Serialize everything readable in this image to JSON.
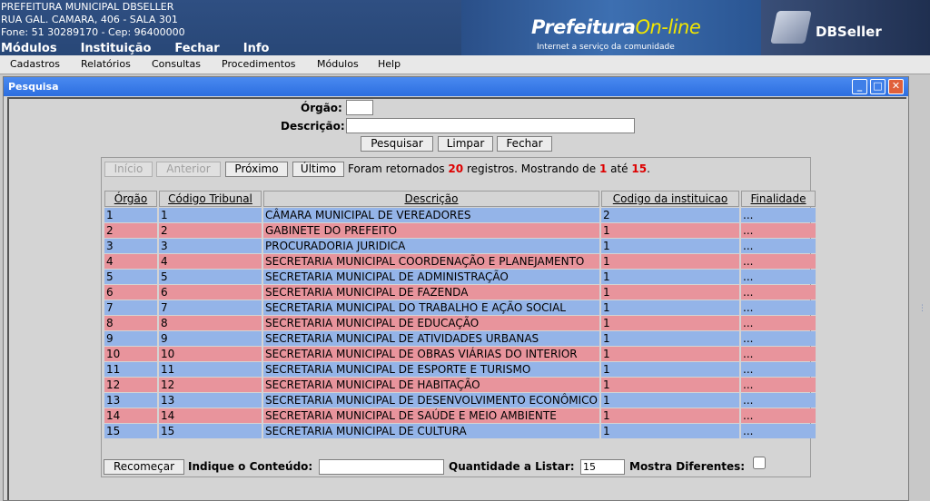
{
  "header": {
    "org_lines": [
      "PREFEITURA MUNICIPAL DBSELLER",
      "RUA GAL. CAMARA, 406 - SALA 301",
      "Fone: 51 30289170  -  Cep: 96400000"
    ],
    "top_menu": [
      "Módulos",
      "Instituição",
      "Fechar",
      "Info"
    ],
    "logo_main": "Prefeitura",
    "logo_online": "On-line",
    "logo_sub": "Internet a serviço da comunidade",
    "brand": "DBSeller"
  },
  "menubar": [
    "Cadastros",
    "Relatórios",
    "Consultas",
    "Procedimentos",
    "Módulos",
    "Help"
  ],
  "window": {
    "title": "Pesquisa",
    "min": "_",
    "max": "□",
    "close": "✕"
  },
  "form": {
    "orgao_label": "Órgão:",
    "orgao_value": "",
    "descricao_label": "Descrição:",
    "descricao_value": "",
    "pesquisar": "Pesquisar",
    "limpar": "Limpar",
    "fechar": "Fechar"
  },
  "pager": {
    "inicio": "Início",
    "anterior": "Anterior",
    "proximo": "Próximo",
    "ultimo": "Último",
    "text1": "Foram retornados ",
    "total": "20",
    "text2": " registros. Mostrando de ",
    "from": "1",
    "text3": " até ",
    "to": "15",
    "text4": "."
  },
  "table": {
    "headers": [
      "Órgão",
      "Código Tribunal",
      "Descrição",
      "Codigo da instituicao",
      "Finalidade"
    ],
    "rows": [
      [
        "1",
        "1",
        "CÂMARA MUNICIPAL DE VEREADORES",
        "2",
        "..."
      ],
      [
        "2",
        "2",
        "GABINETE DO PREFEITO",
        "1",
        "..."
      ],
      [
        "3",
        "3",
        "PROCURADORIA JURIDICA",
        "1",
        "..."
      ],
      [
        "4",
        "4",
        "SECRETARIA MUNICIPAL COORDENAÇÃO E PLANEJAMENTO",
        "1",
        "..."
      ],
      [
        "5",
        "5",
        "SECRETARIA MUNICIPAL DE ADMINISTRAÇÃO",
        "1",
        "..."
      ],
      [
        "6",
        "6",
        "SECRETARIA MUNICIPAL DE FAZENDA",
        "1",
        "..."
      ],
      [
        "7",
        "7",
        "SECRETARIA MUNICIPAL DO TRABALHO E AÇÃO SOCIAL",
        "1",
        "..."
      ],
      [
        "8",
        "8",
        "SECRETARIA MUNICIPAL DE EDUCAÇÃO",
        "1",
        "..."
      ],
      [
        "9",
        "9",
        "SECRETARIA MUNICIPAL DE ATIVIDADES URBANAS",
        "1",
        "..."
      ],
      [
        "10",
        "10",
        "SECRETARIA MUNICIPAL DE OBRAS VIÁRIAS DO INTERIOR",
        "1",
        "..."
      ],
      [
        "11",
        "11",
        "SECRETARIA MUNICIPAL DE ESPORTE E TURISMO",
        "1",
        "..."
      ],
      [
        "12",
        "12",
        "SECRETARIA MUNICIPAL DE HABITAÇÃO",
        "1",
        "..."
      ],
      [
        "13",
        "13",
        "SECRETARIA MUNICIPAL DE DESENVOLVIMENTO ECONÔMICO",
        "1",
        "..."
      ],
      [
        "14",
        "14",
        "SECRETARIA MUNICIPAL DE SAÚDE E MEIO AMBIENTE",
        "1",
        "..."
      ],
      [
        "15",
        "15",
        "SECRETARIA MUNICIPAL DE CULTURA",
        "1",
        "..."
      ]
    ]
  },
  "footer": {
    "recomecar": "Recomeçar",
    "indique_label": "Indique o Conteúdo:",
    "indique_value": "",
    "quantidade_label": "Quantidade a Listar:",
    "quantidade_value": "15",
    "mostra_label": "Mostra Diferentes:"
  },
  "colors": {
    "row_odd": "#94b4e8",
    "row_even": "#e8949c",
    "title_bar": "#2c6ee0",
    "highlight_red": "#dd0000"
  }
}
